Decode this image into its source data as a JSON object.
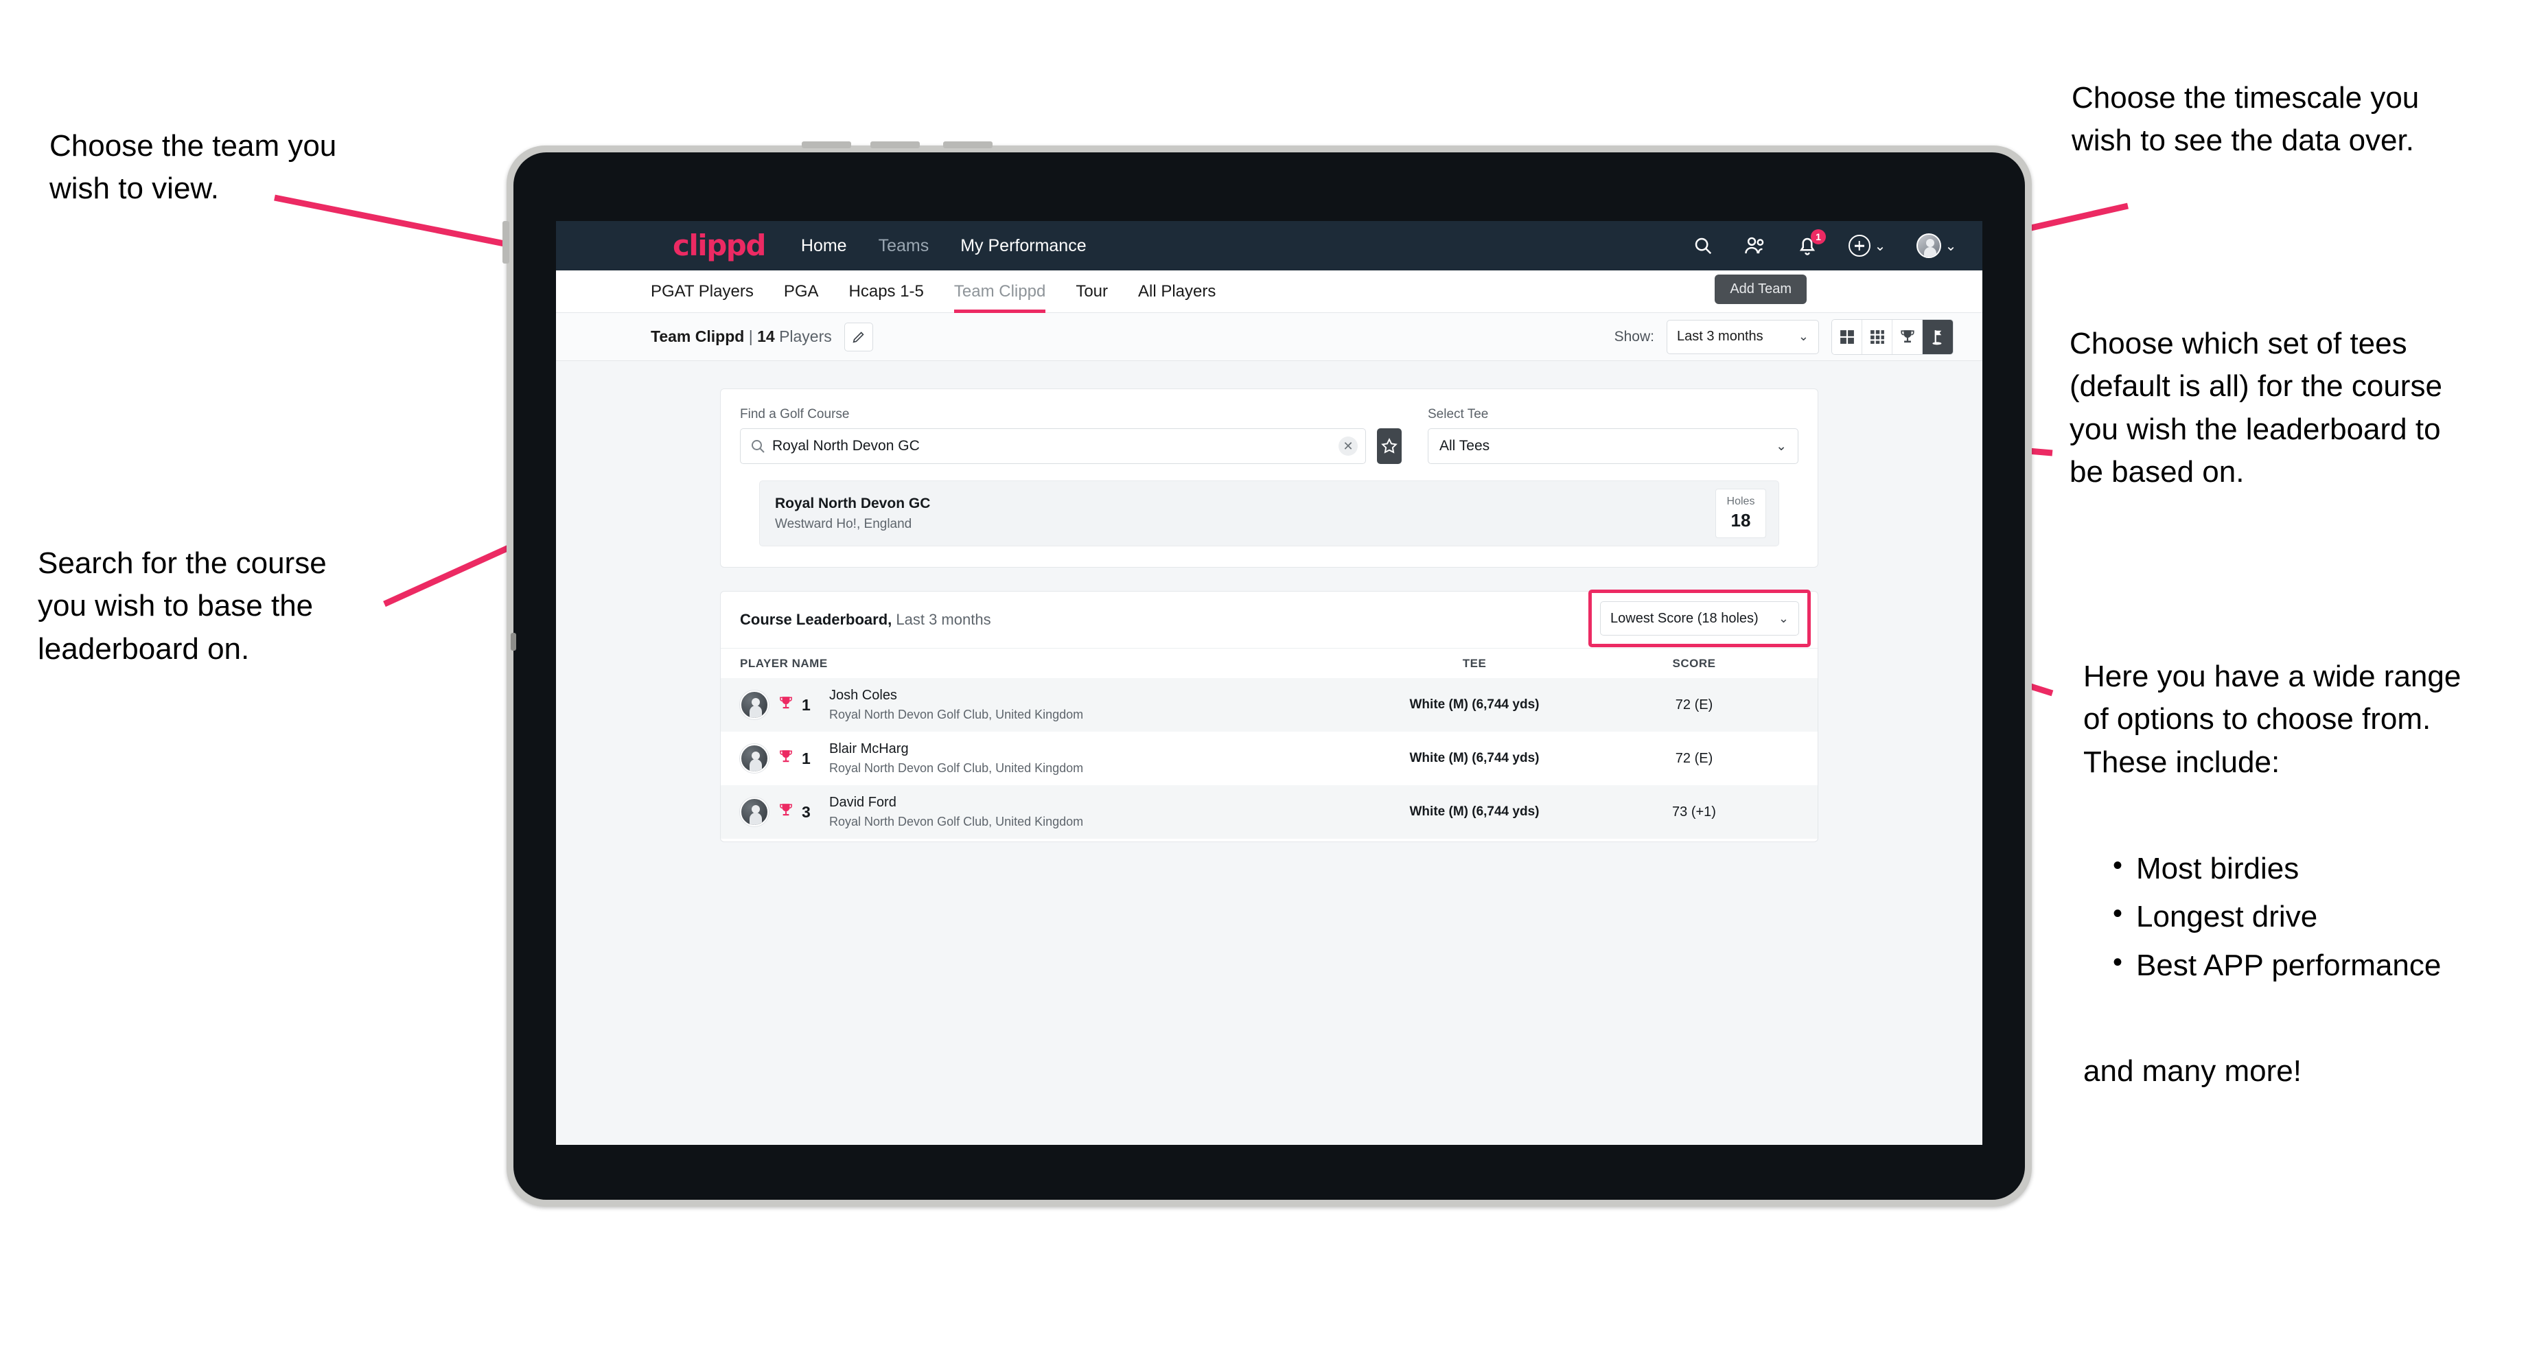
{
  "annotations": {
    "team": "Choose the team you\nwish to view.",
    "search": "Search for the course\nyou wish to base the\nleaderboard on.",
    "timescale": "Choose the timescale you\nwish to see the data over.",
    "tees": "Choose which set of tees\n(default is all) for the course\nyou wish the leaderboard to\nbe based on.",
    "options_intro": "Here you have a wide range\nof options to choose from.\nThese include:",
    "options_list": [
      "Most birdies",
      "Longest drive",
      "Best APP performance"
    ],
    "options_outro": "and many more!"
  },
  "colors": {
    "brand_pink": "#ec2a63",
    "nav_dark": "#1d2b38",
    "active_dark": "#41474d"
  },
  "topnav": {
    "logo": "clippd",
    "links": [
      {
        "label": "Home",
        "dim": false
      },
      {
        "label": "Teams",
        "dim": true
      },
      {
        "label": "My Performance",
        "dim": false
      }
    ],
    "icons": [
      "search-icon",
      "people-icon",
      "bell-icon",
      "plus-circle-icon",
      "avatar-icon"
    ],
    "notification_count": "1"
  },
  "subnav": {
    "tabs": [
      {
        "label": "PGAT Players",
        "active": false
      },
      {
        "label": "PGA",
        "active": false
      },
      {
        "label": "Hcaps 1-5",
        "active": false
      },
      {
        "label": "Team Clippd",
        "active": true
      },
      {
        "label": "Tour",
        "active": false
      },
      {
        "label": "All Players",
        "active": false
      }
    ],
    "tooltip": "Add Team"
  },
  "toolbar": {
    "team_name": "Team Clippd",
    "separator": " | ",
    "player_count": "14",
    "players_word": "Players",
    "edit_icon": "pencil-icon",
    "show_label": "Show:",
    "timescale_value": "Last 3 months",
    "view_buttons": [
      {
        "name": "grid-2x2-view",
        "active": false
      },
      {
        "name": "grid-3x3-view",
        "active": false
      },
      {
        "name": "trophy-view",
        "active": false
      },
      {
        "name": "course-flag-view",
        "active": true
      }
    ]
  },
  "search_card": {
    "course_label": "Find a Golf Course",
    "course_value": "Royal North Devon GC",
    "course_placeholder": "Find a Golf Course",
    "clear_glyph": "✕",
    "favourite_icon": "star-icon",
    "tee_label": "Select Tee",
    "tee_value": "All Tees"
  },
  "course_result": {
    "name": "Royal North Devon GC",
    "location": "Westward Ho!, England",
    "holes_label": "Holes",
    "holes_value": "18"
  },
  "leaderboard": {
    "title": "Course Leaderboard,",
    "subtitle": " Last 3 months",
    "metric_value": "Lowest Score (18 holes)",
    "columns": [
      "PLAYER NAME",
      "TEE",
      "SCORE"
    ],
    "rows": [
      {
        "rank": "1",
        "name": "Josh Coles",
        "club": "Royal North Devon Golf Club, United Kingdom",
        "tee": "White (M) (6,744 yds)",
        "score": "72 (E)"
      },
      {
        "rank": "1",
        "name": "Blair McHarg",
        "club": "Royal North Devon Golf Club, United Kingdom",
        "tee": "White (M) (6,744 yds)",
        "score": "72 (E)"
      },
      {
        "rank": "3",
        "name": "David Ford",
        "club": "Royal North Devon Golf Club, United Kingdom",
        "tee": "White (M) (6,744 yds)",
        "score": "73 (+1)"
      }
    ]
  }
}
